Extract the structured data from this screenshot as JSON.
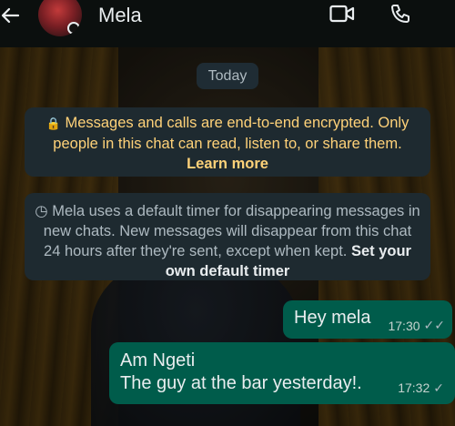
{
  "header": {
    "contact_name": "Mela",
    "back_icon": "arrow-left-icon",
    "video_icon": "video-camera-icon",
    "call_icon": "phone-icon"
  },
  "chat": {
    "date_label": "Today",
    "encryption_notice": {
      "text": "Messages and calls are end-to-end encrypted. Only people in this chat can read, listen to, or share them.",
      "link": "Learn more"
    },
    "timer_notice": {
      "text": "Mela uses a default timer for disappearing messages in new chats. New messages will disappear from this chat 24 hours after they're sent, except when kept.",
      "link": "Set your own default timer"
    },
    "messages": [
      {
        "text": "Hey mela",
        "time": "17:30",
        "status": "read"
      },
      {
        "line1": "Am Ngeti",
        "line2": "The guy at the bar yesterday!.",
        "time": "17:32",
        "status": "sent"
      }
    ]
  },
  "colors": {
    "header_bg": "#0b0f0e",
    "outgoing_bubble": "#005c4b",
    "notice_bg": "#1e2a30",
    "notice_text": "#ffd279"
  }
}
